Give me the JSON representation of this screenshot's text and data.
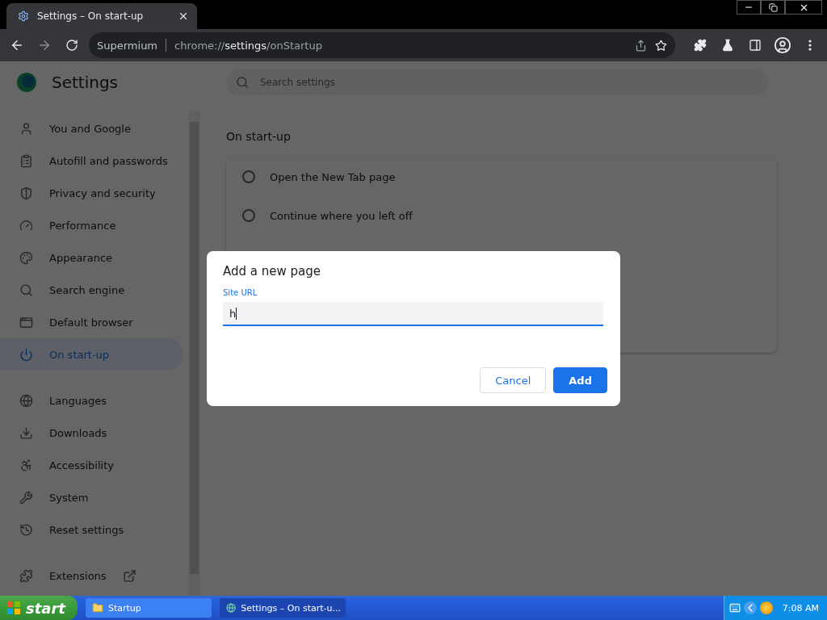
{
  "browser": {
    "tab": {
      "title": "Settings – On start-up"
    },
    "address": {
      "site": "Supermium",
      "url_scheme": "chrome://",
      "url_host": "settings",
      "url_path": "/onStartup"
    }
  },
  "settings": {
    "title": "Settings",
    "search": {
      "placeholder": "Search settings"
    },
    "nav_groups": [
      [
        {
          "label": "You and Google",
          "selected": false
        },
        {
          "label": "Autofill and passwords",
          "selected": false
        },
        {
          "label": "Privacy and security",
          "selected": false
        },
        {
          "label": "Performance",
          "selected": false
        },
        {
          "label": "Appearance",
          "selected": false
        },
        {
          "label": "Search engine",
          "selected": false
        },
        {
          "label": "Default browser",
          "selected": false
        },
        {
          "label": "On start-up",
          "selected": true
        }
      ],
      [
        {
          "label": "Languages",
          "selected": false
        },
        {
          "label": "Downloads",
          "selected": false
        },
        {
          "label": "Accessibility",
          "selected": false
        },
        {
          "label": "System",
          "selected": false
        },
        {
          "label": "Reset settings",
          "selected": false
        }
      ],
      [
        {
          "label": "Extensions",
          "selected": false,
          "kind": "external"
        }
      ]
    ],
    "section": {
      "heading": "On start-up",
      "options": [
        {
          "label": "Open the New Tab page",
          "selected": false
        },
        {
          "label": "Continue where you left off",
          "selected": false
        }
      ]
    }
  },
  "dialog": {
    "title": "Add a new page",
    "field": {
      "label": "Site URL",
      "value": "h"
    },
    "buttons": [
      {
        "label": "Cancel",
        "kind": "secondary"
      },
      {
        "label": "Add",
        "kind": "primary"
      }
    ]
  },
  "taskbar": {
    "start": "start",
    "tasks": [
      {
        "label": "Startup",
        "kind": "folder",
        "selected": false
      },
      {
        "label": "Settings – On start-u...",
        "kind": "browser",
        "selected": true
      }
    ],
    "time": "7:08 AM"
  }
}
